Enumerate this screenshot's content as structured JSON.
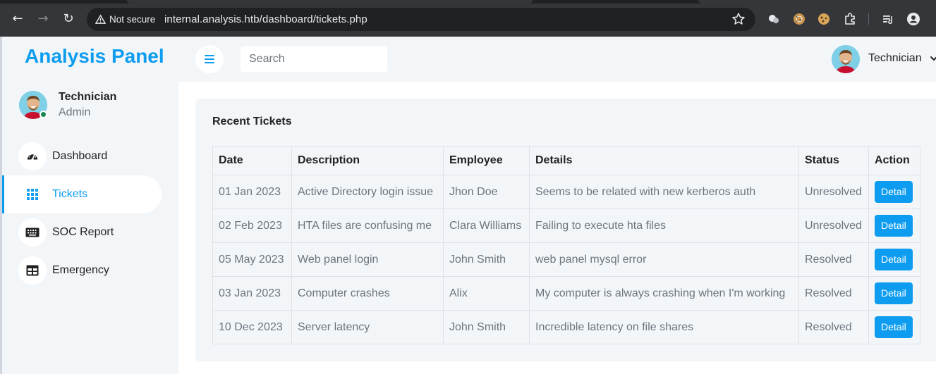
{
  "browser": {
    "security_label": "Not secure",
    "url": "internal.analysis.htb/dashboard/tickets.php"
  },
  "sidebar": {
    "brand": "Analysis Panel",
    "profile": {
      "name": "Technician",
      "role": "Admin",
      "status": "online"
    },
    "items": [
      {
        "label": "Dashboard",
        "icon": "gauge-icon",
        "active": false
      },
      {
        "label": "Tickets",
        "icon": "grid-icon",
        "active": true
      },
      {
        "label": "SOC Report",
        "icon": "keyboard-icon",
        "active": false
      },
      {
        "label": "Emergency",
        "icon": "table-icon",
        "active": false
      }
    ]
  },
  "topbar": {
    "search_placeholder": "Search",
    "user_name": "Technician"
  },
  "tickets": {
    "title": "Recent Tickets",
    "columns": [
      "Date",
      "Description",
      "Employee",
      "Details",
      "Status",
      "Action"
    ],
    "rows": [
      [
        "01 Jan 2023",
        "Active Directory login issue",
        "Jhon Doe",
        "Seems to be related with new kerberos auth",
        "Unresolved",
        "Detail"
      ],
      [
        "02 Feb 2023",
        "HTA files are confusing me",
        "Clara Williams",
        "Failing to execute hta files",
        "Unresolved",
        "Detail"
      ],
      [
        "05 May 2023",
        "Web panel login",
        "John Smith",
        "web panel mysql error",
        "Resolved",
        "Detail"
      ],
      [
        "03 Jan 2023",
        "Computer crashes",
        "Alix",
        "My computer is always crashing when I'm working",
        "Resolved",
        "Detail"
      ],
      [
        "10 Dec 2023",
        "Server latency",
        "John Smith",
        "Incredible latency on file shares",
        "Resolved",
        "Detail"
      ]
    ]
  },
  "colors": {
    "accent": "#0d9cf0",
    "online": "#198754"
  }
}
